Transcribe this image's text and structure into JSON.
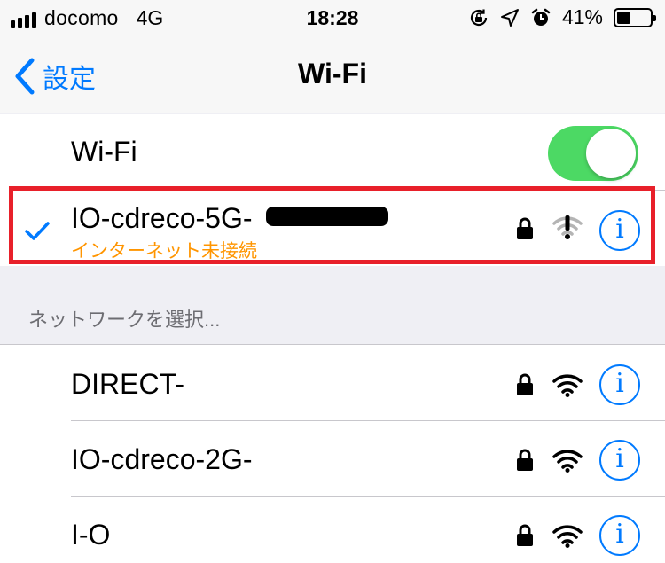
{
  "status_bar": {
    "carrier": "docomo",
    "network": "4G",
    "time": "18:28",
    "battery_percent": "41%",
    "battery_level": 0.41
  },
  "nav": {
    "back_label": "設定",
    "title": "Wi-Fi"
  },
  "wifi_toggle": {
    "label": "Wi-Fi",
    "on": true
  },
  "connected_network": {
    "name": "IO-cdreco-5G-",
    "status": "インターネット未接続"
  },
  "section_header": "ネットワークを選択...",
  "networks": [
    {
      "name": "DIRECT-"
    },
    {
      "name": "IO-cdreco-2G-"
    },
    {
      "name": "I-O"
    }
  ],
  "colors": {
    "accent": "#007aff",
    "toggle_on": "#4cd964",
    "warning": "#ff9500",
    "highlight_border": "#e8202a"
  },
  "icons": {
    "signal": "cellular-signal-icon",
    "orientation_lock": "orientation-lock-icon",
    "location": "location-arrow-icon",
    "alarm": "alarm-clock-icon",
    "battery": "battery-icon",
    "back": "chevron-left-icon",
    "check": "checkmark-icon",
    "lock": "lock-icon",
    "wifi": "wifi-icon",
    "wifi_warning": "wifi-warning-icon",
    "info": "info-icon"
  }
}
